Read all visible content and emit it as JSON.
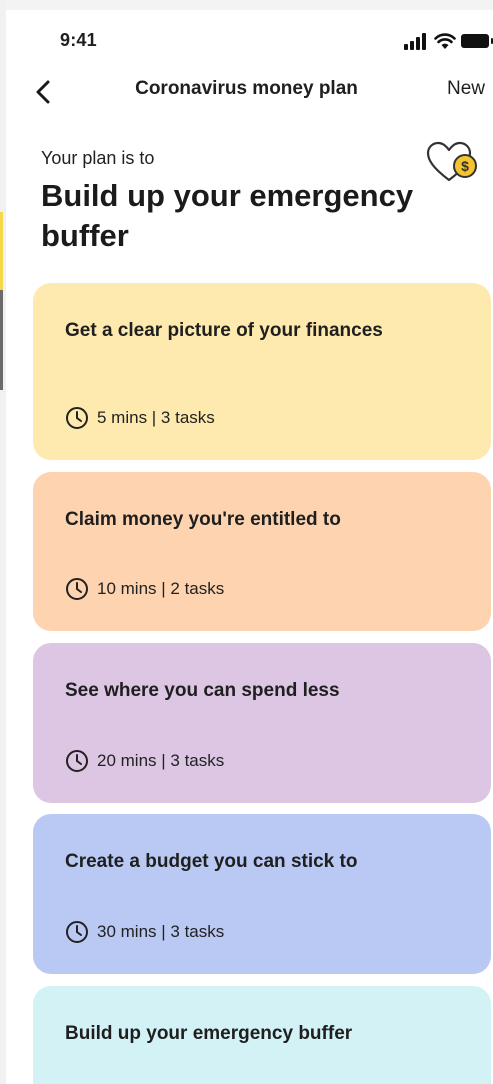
{
  "status_bar": {
    "time": "9:41"
  },
  "nav": {
    "title": "Coronavirus money plan",
    "right_action": "New"
  },
  "plan": {
    "intro": "Your plan is to",
    "title": "Build up your emergency buffer"
  },
  "cards": [
    {
      "title": "Get a clear picture of your finances",
      "meta": "5 mins | 3 tasks",
      "color": "#feeaae"
    },
    {
      "title": "Claim money you're entitled to",
      "meta": "10 mins | 2 tasks",
      "color": "#fdd3b0"
    },
    {
      "title": "See where you can spend less",
      "meta": "20 mins | 3 tasks",
      "color": "#dcc6e4"
    },
    {
      "title": "Create a budget you can stick to",
      "meta": "30 mins | 3 tasks",
      "color": "#b9c9f4"
    },
    {
      "title": "Build up your emergency buffer",
      "color": "#d3f2f5"
    }
  ],
  "icons": {
    "back": "chevron-left-icon",
    "heart": "heart-coin-icon",
    "clock": "clock-icon"
  },
  "accent": "#f4c430"
}
